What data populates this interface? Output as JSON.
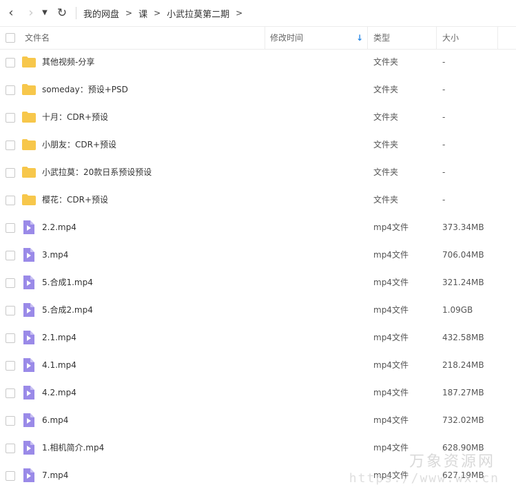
{
  "toolbar": {
    "back_icon": "chevron-left-icon",
    "forward_icon": "chevron-right-icon",
    "dropdown_icon": "caret-down-icon",
    "refresh_icon": "refresh-icon",
    "breadcrumb": [
      "我的网盘",
      "课",
      "小武拉莫第二期"
    ],
    "separator": ">"
  },
  "header": {
    "name": "文件名",
    "modified": "修改时间",
    "type": "类型",
    "size": "大小",
    "sort_icon": "arrow-down-icon",
    "accent": "#2d8ae6"
  },
  "rows": [
    {
      "name": "其他视频-分享",
      "type": "文件夹",
      "size": "-",
      "kind": "folder"
    },
    {
      "name": "someday：预设+PSD",
      "type": "文件夹",
      "size": "-",
      "kind": "folder"
    },
    {
      "name": "十月：CDR+预设",
      "type": "文件夹",
      "size": "-",
      "kind": "folder"
    },
    {
      "name": "小朋友：CDR+预设",
      "type": "文件夹",
      "size": "-",
      "kind": "folder"
    },
    {
      "name": "小武拉莫：20款日系预设预设",
      "type": "文件夹",
      "size": "-",
      "kind": "folder"
    },
    {
      "name": "樱花：CDR+预设",
      "type": "文件夹",
      "size": "-",
      "kind": "folder"
    },
    {
      "name": "2.2.mp4",
      "type": "mp4文件",
      "size": "373.34MB",
      "kind": "video"
    },
    {
      "name": "3.mp4",
      "type": "mp4文件",
      "size": "706.04MB",
      "kind": "video"
    },
    {
      "name": "5.合成1.mp4",
      "type": "mp4文件",
      "size": "321.24MB",
      "kind": "video"
    },
    {
      "name": "5.合成2.mp4",
      "type": "mp4文件",
      "size": "1.09GB",
      "kind": "video"
    },
    {
      "name": "2.1.mp4",
      "type": "mp4文件",
      "size": "432.58MB",
      "kind": "video"
    },
    {
      "name": "4.1.mp4",
      "type": "mp4文件",
      "size": "218.24MB",
      "kind": "video"
    },
    {
      "name": "4.2.mp4",
      "type": "mp4文件",
      "size": "187.27MB",
      "kind": "video"
    },
    {
      "name": "6.mp4",
      "type": "mp4文件",
      "size": "732.02MB",
      "kind": "video"
    },
    {
      "name": "1.相机简介.mp4",
      "type": "mp4文件",
      "size": "628.90MB",
      "kind": "video"
    },
    {
      "name": "7.mp4",
      "type": "mp4文件",
      "size": "627.19MB",
      "kind": "video"
    }
  ],
  "colors": {
    "folder": "#f7c74b",
    "video": "#9a8ae8"
  },
  "watermark": {
    "brand": "万象资源网",
    "url": "https://www.wx.cn"
  }
}
